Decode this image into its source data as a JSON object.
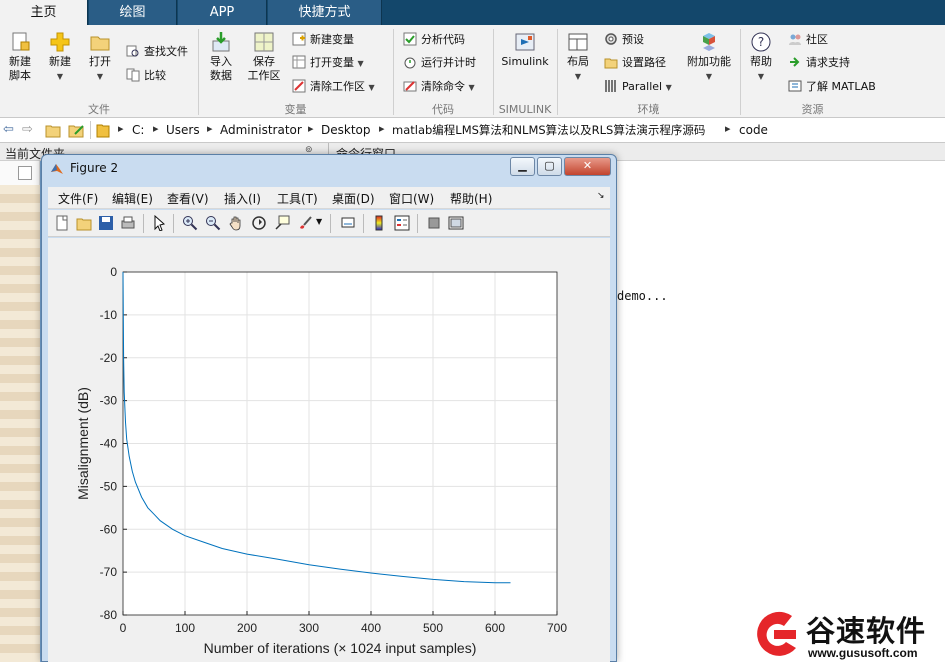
{
  "tabs": [
    "主页",
    "绘图",
    "APP",
    "快捷方式"
  ],
  "ribbon": {
    "file": {
      "new_script": [
        "新建",
        "脚本"
      ],
      "new": "新建",
      "open": "打开",
      "find_files": "查找文件",
      "compare": "比较",
      "label": "文件"
    },
    "variable": {
      "import": [
        "导入",
        "数据"
      ],
      "save_ws": [
        "保存",
        "工作区"
      ],
      "new_var": "新建变量",
      "open_var": "打开变量",
      "clear_ws": "清除工作区",
      "label": "变量"
    },
    "code": {
      "analyze": "分析代码",
      "run_time": "运行并计时",
      "clear_cmd": "清除命令",
      "label": "代码"
    },
    "simulink": {
      "btn": "Simulink",
      "label": "SIMULINK"
    },
    "env": {
      "layout": "布局",
      "prefs": "预设",
      "set_path": "设置路径",
      "parallel": "Parallel",
      "addons": "附加功能",
      "label": "环境"
    },
    "resources": {
      "help": "帮助",
      "community": "社区",
      "support": "请求支持",
      "learn": "了解 MATLAB",
      "label": "资源"
    }
  },
  "path": [
    "C:",
    "Users",
    "Administrator",
    "Desktop",
    "matlab编程LMS算法和NLMS算法以及RLS算法演示程序源码",
    "code"
  ],
  "panels": {
    "current_folder": "当前文件夹",
    "command_window": "命令行窗口"
  },
  "command_output": "demo...",
  "figure": {
    "title": "Figure 2",
    "menu": [
      "文件(F)",
      "编辑(E)",
      "查看(V)",
      "插入(I)",
      "工具(T)",
      "桌面(D)",
      "窗口(W)",
      "帮助(H)"
    ]
  },
  "chart_data": {
    "type": "line",
    "title": "",
    "xlabel": "Number of iterations (× 1024 input samples)",
    "ylabel": "Misalignment (dB)",
    "xlim": [
      0,
      700
    ],
    "ylim": [
      -80,
      0
    ],
    "xticks": [
      "0",
      "100",
      "200",
      "300",
      "400",
      "500",
      "600",
      "700"
    ],
    "yticks": [
      "0",
      "-10",
      "-20",
      "-30",
      "-40",
      "-50",
      "-60",
      "-70",
      "-80"
    ],
    "grid": true,
    "color": "#0072bd",
    "x": [
      0,
      1,
      2,
      4,
      6,
      10,
      15,
      20,
      30,
      40,
      50,
      60,
      80,
      100,
      130,
      160,
      200,
      250,
      300,
      350,
      400,
      450,
      500,
      550,
      600,
      625
    ],
    "y": [
      0,
      -20,
      -28,
      -35,
      -39,
      -43,
      -46.5,
      -49,
      -52.5,
      -55,
      -56.5,
      -58,
      -60,
      -61.5,
      -63,
      -64.5,
      -65.8,
      -67,
      -68.3,
      -69.3,
      -70.2,
      -71,
      -71.7,
      -72.2,
      -72.5,
      -72.5
    ]
  },
  "watermark": {
    "brand": "谷速软件",
    "url": "www.gususoft.com"
  }
}
